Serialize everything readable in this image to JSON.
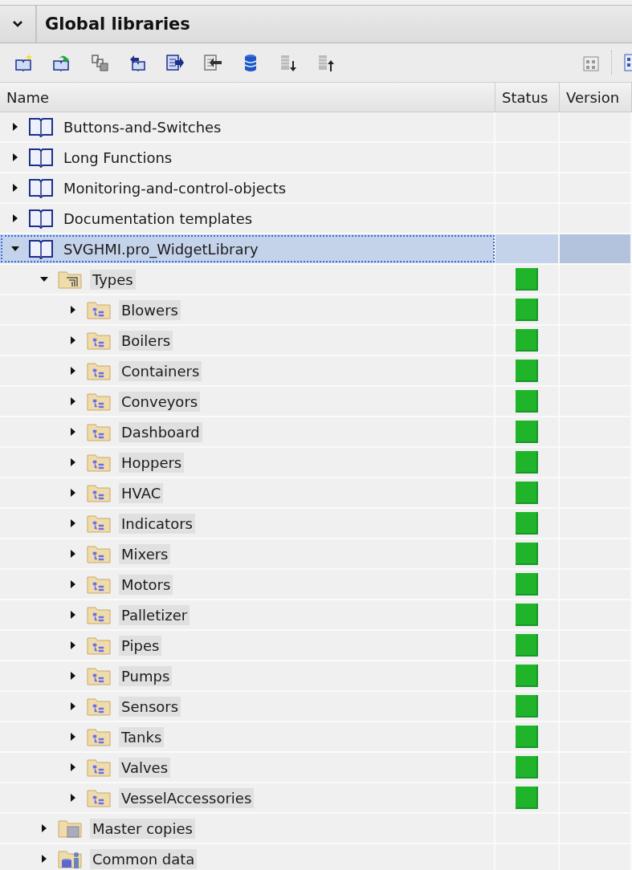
{
  "panel": {
    "title": "Global libraries"
  },
  "toolbar": {
    "left_buttons": [
      {
        "kind": "book-star"
      },
      {
        "kind": "book-arrow"
      },
      {
        "kind": "copy-disk"
      },
      {
        "kind": "book-undo"
      },
      {
        "kind": "doc-right"
      },
      {
        "kind": "doc-left"
      },
      {
        "kind": "database"
      },
      {
        "kind": "list-down"
      },
      {
        "kind": "list-up"
      }
    ],
    "right_buttons": [
      {
        "kind": "grid-doc"
      },
      {
        "kind": "grid"
      }
    ]
  },
  "columns": [
    "Name",
    "Status",
    "Version"
  ],
  "tree": [
    {
      "label": "Buttons-and-Switches",
      "kind": "library",
      "expanded": false,
      "selected": false
    },
    {
      "label": "Long Functions",
      "kind": "library",
      "expanded": false,
      "selected": false
    },
    {
      "label": "Monitoring-and-control-objects",
      "kind": "library",
      "expanded": false,
      "selected": false
    },
    {
      "label": "Documentation templates",
      "kind": "library",
      "expanded": false,
      "selected": false
    },
    {
      "label": "SVGHMI.pro_WidgetLibrary",
      "kind": "library",
      "expanded": true,
      "selected": true,
      "children": [
        {
          "label": "Types",
          "kind": "types",
          "expanded": true,
          "selected": false,
          "status_ok": true,
          "children": [
            {
              "label": "Blowers",
              "kind": "type-folder",
              "expanded": false,
              "selected": false,
              "status_ok": true
            },
            {
              "label": "Boilers",
              "kind": "type-folder",
              "expanded": false,
              "selected": false,
              "status_ok": true
            },
            {
              "label": "Containers",
              "kind": "type-folder",
              "expanded": false,
              "selected": false,
              "status_ok": true
            },
            {
              "label": "Conveyors",
              "kind": "type-folder",
              "expanded": false,
              "selected": false,
              "status_ok": true
            },
            {
              "label": "Dashboard",
              "kind": "type-folder",
              "expanded": false,
              "selected": false,
              "status_ok": true
            },
            {
              "label": "Hoppers",
              "kind": "type-folder",
              "expanded": false,
              "selected": false,
              "status_ok": true
            },
            {
              "label": "HVAC",
              "kind": "type-folder",
              "expanded": false,
              "selected": false,
              "status_ok": true
            },
            {
              "label": "Indicators",
              "kind": "type-folder",
              "expanded": false,
              "selected": false,
              "status_ok": true
            },
            {
              "label": "Mixers",
              "kind": "type-folder",
              "expanded": false,
              "selected": false,
              "status_ok": true
            },
            {
              "label": "Motors",
              "kind": "type-folder",
              "expanded": false,
              "selected": false,
              "status_ok": true
            },
            {
              "label": "Palletizer",
              "kind": "type-folder",
              "expanded": false,
              "selected": false,
              "status_ok": true
            },
            {
              "label": "Pipes",
              "kind": "type-folder",
              "expanded": false,
              "selected": false,
              "status_ok": true
            },
            {
              "label": "Pumps",
              "kind": "type-folder",
              "expanded": false,
              "selected": false,
              "status_ok": true
            },
            {
              "label": "Sensors",
              "kind": "type-folder",
              "expanded": false,
              "selected": false,
              "status_ok": true
            },
            {
              "label": "Tanks",
              "kind": "type-folder",
              "expanded": false,
              "selected": false,
              "status_ok": true
            },
            {
              "label": "Valves",
              "kind": "type-folder",
              "expanded": false,
              "selected": false,
              "status_ok": true
            },
            {
              "label": "VesselAccessories",
              "kind": "type-folder",
              "expanded": false,
              "selected": false,
              "status_ok": true
            }
          ]
        },
        {
          "label": "Master copies",
          "kind": "master-copies",
          "expanded": false,
          "selected": false
        },
        {
          "label": "Common data",
          "kind": "common-data",
          "expanded": false,
          "selected": false
        }
      ]
    }
  ]
}
